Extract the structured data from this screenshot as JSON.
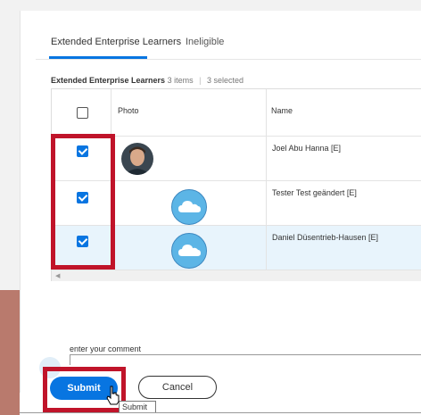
{
  "tabs": [
    {
      "label": "Extended Enterprise Learners",
      "active": true
    },
    {
      "label": "Ineligible",
      "active": false
    }
  ],
  "grid": {
    "title": "Extended Enterprise Learners",
    "items_count": "3 items",
    "selected_count": "3 selected",
    "columns": {
      "photo": "Photo",
      "name": "Name"
    },
    "rows": [
      {
        "name": "Joel Abu Hanna [E]",
        "checked": true,
        "avatar": "photo-avatar"
      },
      {
        "name": "Tester Test geändert [E]",
        "checked": true,
        "avatar": "cloud-avatar"
      },
      {
        "name": "Daniel Düsentrieb-Hausen [E]",
        "checked": true,
        "avatar": "cloud-avatar"
      }
    ]
  },
  "comment": {
    "label": "enter your comment",
    "value": ""
  },
  "actions": {
    "submit_label": "Submit",
    "cancel_label": "Cancel"
  },
  "tooltip": {
    "text": "Submit"
  },
  "colors": {
    "accent": "#0875e1",
    "highlight": "#c0142a",
    "selected_row": "#e8f4fc"
  }
}
